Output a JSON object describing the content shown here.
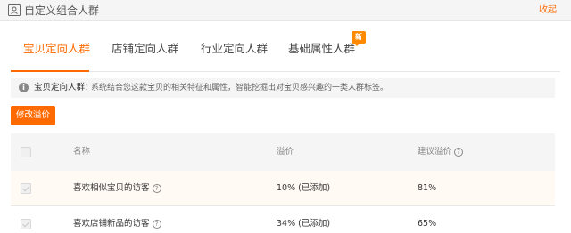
{
  "header": {
    "title": "自定义组合人群",
    "collapse_label": "收起",
    "icon": "crowd-card-icon"
  },
  "tabs": [
    {
      "label": "宝贝定向人群",
      "active": true
    },
    {
      "label": "店铺定向人群",
      "active": false
    },
    {
      "label": "行业定向人群",
      "active": false
    },
    {
      "label": "基础属性人群",
      "active": false,
      "badge": "新"
    }
  ],
  "notice": {
    "icon": "info-icon",
    "label": "宝贝定向人群：",
    "text": "系统结合您这款宝贝的相关特征和属性，智能挖掘出对宝贝感兴趣的一类人群标签。"
  },
  "modify_button": {
    "label": "修改溢价"
  },
  "table": {
    "columns": {
      "name": "名称",
      "premium": "溢价",
      "suggested": "建议溢价"
    },
    "rows": [
      {
        "name": "喜欢相似宝贝的访客",
        "premium": "10% (已添加)",
        "suggested": "81%",
        "checked": true
      },
      {
        "name": "喜欢店铺新品的访客",
        "premium": "34% (已添加)",
        "suggested": "65%",
        "checked": true
      }
    ]
  },
  "colors": {
    "accent": "#ff6a00",
    "badge": "#ff8a00"
  }
}
